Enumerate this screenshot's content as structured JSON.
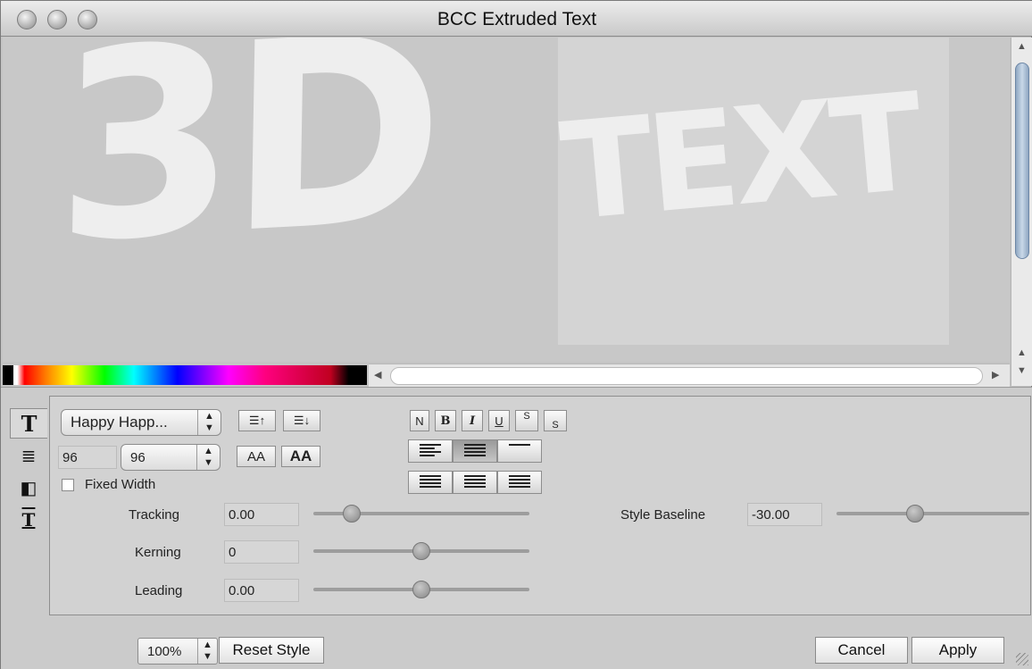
{
  "window": {
    "title": "BCC Extruded Text"
  },
  "preview": {
    "line1": "3D",
    "line2": "TEXT"
  },
  "side_tabs": [
    "T",
    "≣",
    "◧",
    "T"
  ],
  "font": {
    "name": "Happy Happ...",
    "size": "96",
    "size_popup": "96"
  },
  "style_buttons": [
    "N",
    "B",
    "I",
    "U",
    "S",
    "S"
  ],
  "case_buttons": [
    "AA",
    "AA"
  ],
  "fixed_width": {
    "label": "Fixed Width",
    "checked": false
  },
  "tracking": {
    "label": "Tracking",
    "value": "0.00",
    "level": 0.15
  },
  "kerning": {
    "label": "Kerning",
    "value": "0",
    "level": 0.5
  },
  "leading": {
    "label": "Leading",
    "value": "0.00",
    "level": 0.5
  },
  "style_baseline": {
    "label": "Style Baseline",
    "value": "-30.00",
    "level": 0.4
  },
  "footer": {
    "zoom": "100%",
    "reset_label": "Reset Style",
    "cancel_label": "Cancel",
    "apply_label": "Apply"
  },
  "colors": {
    "accent": "#8fa7c2",
    "panel": "#d2d2d2"
  }
}
